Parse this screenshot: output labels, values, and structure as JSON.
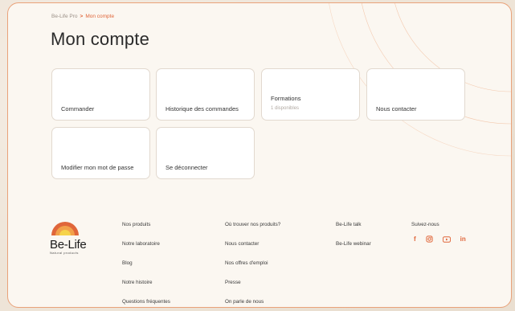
{
  "breadcrumb": {
    "home": "Be-Life Pro",
    "separator": ">",
    "current": "Mon compte"
  },
  "page": {
    "title": "Mon compte"
  },
  "tiles": [
    {
      "label": "Commander"
    },
    {
      "label": "Historique des commandes"
    },
    {
      "label": "Formations",
      "sub": "1 disponibles"
    },
    {
      "label": "Nous contacter"
    },
    {
      "label": "Modifier mon mot de passe"
    },
    {
      "label": "Se déconnecter"
    }
  ],
  "logo": {
    "name": "Be-Life",
    "tagline": "Natural products"
  },
  "footer": {
    "col1": [
      "Nos produits",
      "Notre laboratoire",
      "Blog",
      "Notre histoire",
      "Questions fréquentes"
    ],
    "col2": [
      "Où trouver nos produits?",
      "Nous contacter",
      "Nos offres d'emploi",
      "Presse",
      "On parle de nous"
    ],
    "col3": [
      "Be-Life talk",
      "Be-Life webinar"
    ],
    "follow_title": "Suivez-nous",
    "social_icons": [
      "facebook-icon",
      "instagram-icon",
      "youtube-icon",
      "linkedin-icon"
    ]
  },
  "colors": {
    "accent": "#e0663a",
    "border": "#e9a27a"
  }
}
